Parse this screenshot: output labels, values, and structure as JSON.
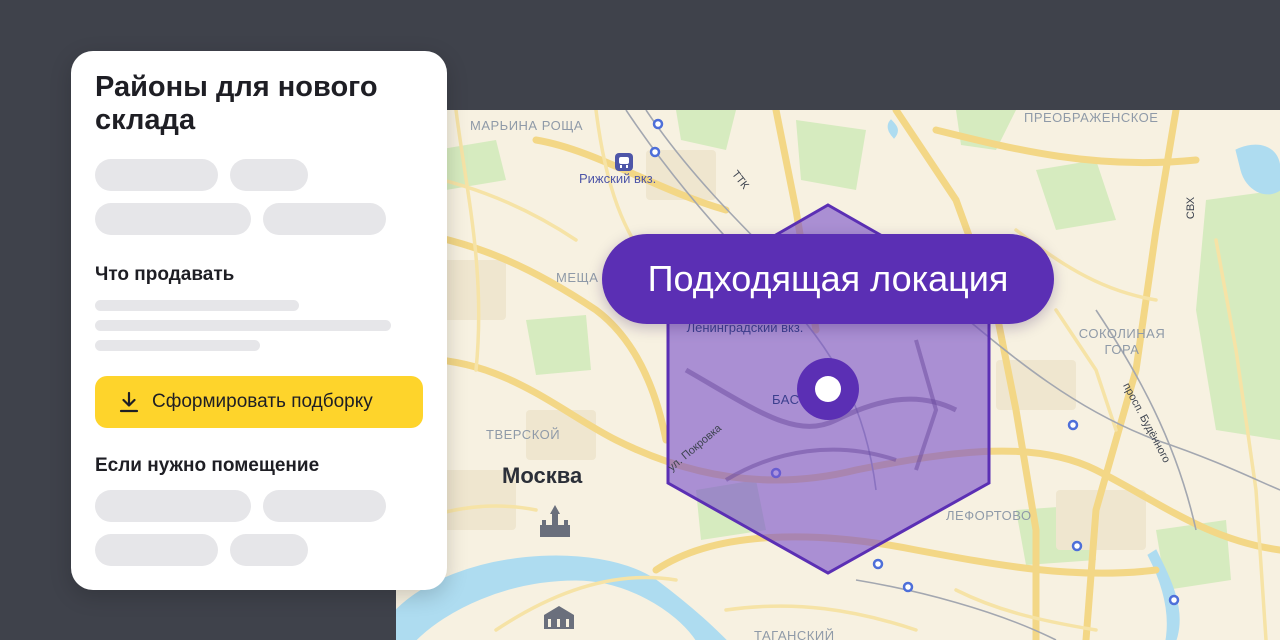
{
  "panel": {
    "title": "Районы для нового склада",
    "section_sell": "Что продавать",
    "cta_label": "Сформировать подборку",
    "cta_icon": "download-icon",
    "section_premises": "Если нужно помещение"
  },
  "location_badge": {
    "label": "Подходящая локация",
    "color": "#5b2fb4"
  },
  "map": {
    "labels": {
      "marina_roshcha": "МАРЬИНА РОЩА",
      "preobrazhenskoe": "ПРЕОБРАЖЕНСКОЕ",
      "rizhsky": "Рижский вкз.",
      "ttk": "ТТК",
      "svh": "СВХ",
      "meshchanskiy": "МЕЩА",
      "leningradsky": "Ленинградский вкз.",
      "basmanny": "БАС",
      "sokolinaya_gora": "СОКОЛИНАЯ ГОРА",
      "tverskoy": "ТВЕРСКОЙ",
      "pokrovka": "ул. Покровка",
      "budyonnogo": "просп. Будённого",
      "moskva": "Москва",
      "lefortovo": "ЛЕФОРТОВО",
      "taganskiy": "ТАГАНСКИЙ"
    },
    "zone_color": "#7b52c9",
    "pin_icon": "location-pin-icon",
    "railway_icon": "railway-station-icon",
    "kremlin_icon": "kremlin-icon"
  },
  "colors": {
    "background": "#3f424b",
    "accent_button": "#fed42b",
    "skeleton": "#e6e6e9"
  }
}
